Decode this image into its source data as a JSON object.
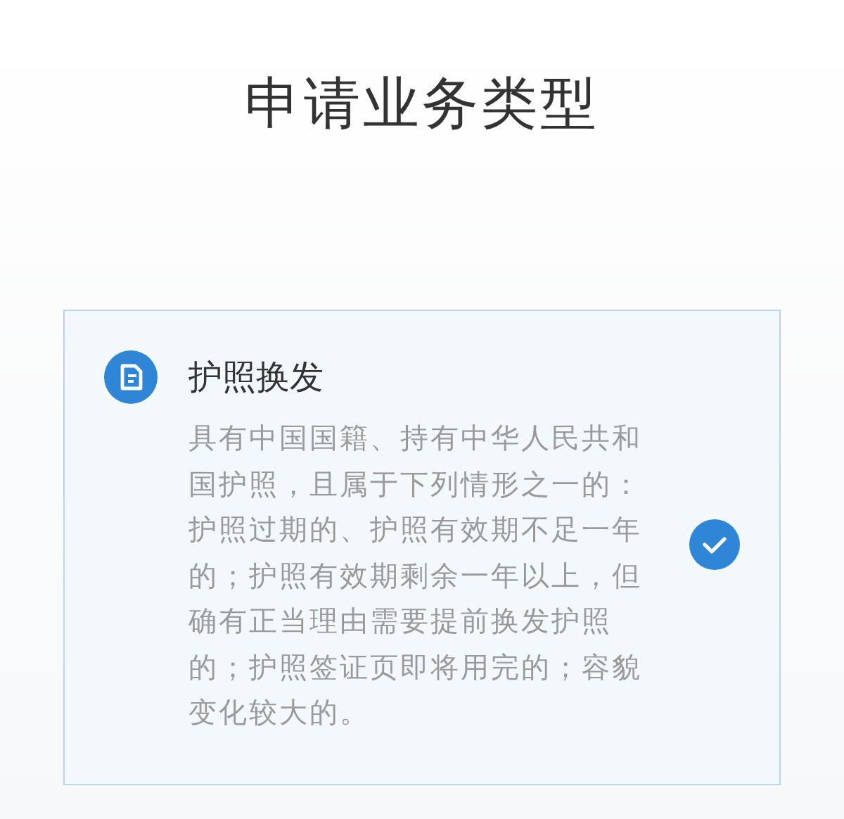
{
  "page": {
    "title": "申请业务类型"
  },
  "options": [
    {
      "title": "护照换发",
      "description": "具有中国国籍、持有中华人民共和国护照，且属于下列情形之一的：护照过期的、护照有效期不足一年的；护照有效期剩余一年以上，但确有正当理由需要提前换发护照的；护照签证页即将用完的；容貌变化较大的。",
      "selected": true
    }
  ]
}
